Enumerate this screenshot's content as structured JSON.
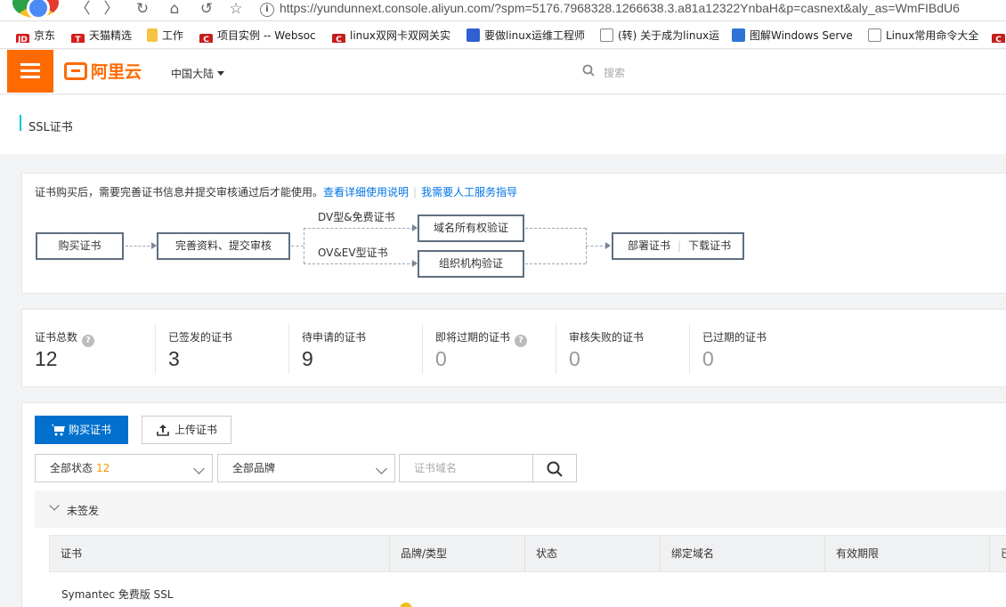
{
  "browser": {
    "url": "https://yundunnext.console.aliyun.com/?spm=5176.7968328.1266638.3.a81a12322YnbaH&p=casnext&aly_as=WmFIBdU6",
    "info_icon": "i",
    "bookmarks": [
      {
        "label": "京东",
        "icon": "JD",
        "color": "#d71c1e"
      },
      {
        "label": "天猫精选",
        "icon": "T",
        "color": "#d71c1e"
      },
      {
        "label": "工作",
        "icon": "",
        "color": "#f6c343"
      },
      {
        "label": "项目实例 -- Websoc",
        "icon": "C",
        "color": "#c41e1e"
      },
      {
        "label": "linux双网卡双网关实",
        "icon": "C",
        "color": "#c41e1e"
      },
      {
        "label": "要做linux运维工程师",
        "icon": "",
        "color": "#2f5fd0"
      },
      {
        "label": "(转) 关于成为linux运",
        "icon": "",
        "color": "#555555"
      },
      {
        "label": "图解Windows Serve",
        "icon": "",
        "color": "#2f73d9"
      },
      {
        "label": "Linux常用命令大全",
        "icon": "",
        "color": "#555555"
      },
      {
        "label": "",
        "icon": "C",
        "color": "#c41e1e"
      }
    ]
  },
  "header": {
    "logo_text": "阿里云",
    "region": "中国大陆",
    "search_placeholder": "搜索"
  },
  "page_title": "SSL证书",
  "flow": {
    "notice": "证书购买后，需要完善证书信息并提交审核通过后才能使用。",
    "link_usage": "查看详细使用说明",
    "link_manual": "我需要人工服务指导",
    "step_buy": "购买证书",
    "step_complete": "完善资料、提交审核",
    "label_dv": "DV型&免费证书",
    "label_ov": "OV&EV型证书",
    "step_domain_verify": "域名所有权验证",
    "step_org_verify": "组织机构验证",
    "step_deploy": "部署证书",
    "step_download": "下载证书"
  },
  "stats": [
    {
      "label": "证书总数",
      "value": "12",
      "help": true
    },
    {
      "label": "已签发的证书",
      "value": "3",
      "help": false
    },
    {
      "label": "待申请的证书",
      "value": "9",
      "help": false
    },
    {
      "label": "即将过期的证书",
      "value": "0",
      "help": true
    },
    {
      "label": "审核失败的证书",
      "value": "0",
      "help": false
    },
    {
      "label": "已过期的证书",
      "value": "0",
      "help": false
    }
  ],
  "help_glyph": "?",
  "toolbar": {
    "buy_label": "购买证书",
    "upload_label": "上传证书",
    "status_filter": "全部状态",
    "status_count": "12",
    "brand_filter": "全部品牌",
    "domain_placeholder": "证书域名"
  },
  "group": {
    "label": "未签发"
  },
  "table": {
    "columns": [
      "证书",
      "品牌/类型",
      "状态",
      "绑定域名",
      "有效期限",
      "已"
    ],
    "rows": [
      {
        "cert": "Symantec 免费版 SSL"
      }
    ]
  }
}
